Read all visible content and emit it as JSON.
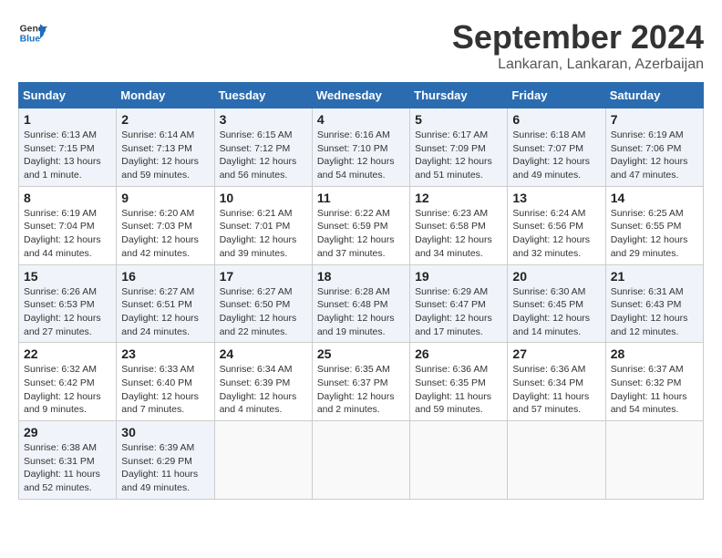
{
  "logo": {
    "line1": "General",
    "line2": "Blue"
  },
  "title": "September 2024",
  "location": "Lankaran, Lankaran, Azerbaijan",
  "weekdays": [
    "Sunday",
    "Monday",
    "Tuesday",
    "Wednesday",
    "Thursday",
    "Friday",
    "Saturday"
  ],
  "weeks": [
    [
      {
        "day": "1",
        "info": "Sunrise: 6:13 AM\nSunset: 7:15 PM\nDaylight: 13 hours\nand 1 minute."
      },
      {
        "day": "2",
        "info": "Sunrise: 6:14 AM\nSunset: 7:13 PM\nDaylight: 12 hours\nand 59 minutes."
      },
      {
        "day": "3",
        "info": "Sunrise: 6:15 AM\nSunset: 7:12 PM\nDaylight: 12 hours\nand 56 minutes."
      },
      {
        "day": "4",
        "info": "Sunrise: 6:16 AM\nSunset: 7:10 PM\nDaylight: 12 hours\nand 54 minutes."
      },
      {
        "day": "5",
        "info": "Sunrise: 6:17 AM\nSunset: 7:09 PM\nDaylight: 12 hours\nand 51 minutes."
      },
      {
        "day": "6",
        "info": "Sunrise: 6:18 AM\nSunset: 7:07 PM\nDaylight: 12 hours\nand 49 minutes."
      },
      {
        "day": "7",
        "info": "Sunrise: 6:19 AM\nSunset: 7:06 PM\nDaylight: 12 hours\nand 47 minutes."
      }
    ],
    [
      {
        "day": "8",
        "info": "Sunrise: 6:19 AM\nSunset: 7:04 PM\nDaylight: 12 hours\nand 44 minutes."
      },
      {
        "day": "9",
        "info": "Sunrise: 6:20 AM\nSunset: 7:03 PM\nDaylight: 12 hours\nand 42 minutes."
      },
      {
        "day": "10",
        "info": "Sunrise: 6:21 AM\nSunset: 7:01 PM\nDaylight: 12 hours\nand 39 minutes."
      },
      {
        "day": "11",
        "info": "Sunrise: 6:22 AM\nSunset: 6:59 PM\nDaylight: 12 hours\nand 37 minutes."
      },
      {
        "day": "12",
        "info": "Sunrise: 6:23 AM\nSunset: 6:58 PM\nDaylight: 12 hours\nand 34 minutes."
      },
      {
        "day": "13",
        "info": "Sunrise: 6:24 AM\nSunset: 6:56 PM\nDaylight: 12 hours\nand 32 minutes."
      },
      {
        "day": "14",
        "info": "Sunrise: 6:25 AM\nSunset: 6:55 PM\nDaylight: 12 hours\nand 29 minutes."
      }
    ],
    [
      {
        "day": "15",
        "info": "Sunrise: 6:26 AM\nSunset: 6:53 PM\nDaylight: 12 hours\nand 27 minutes."
      },
      {
        "day": "16",
        "info": "Sunrise: 6:27 AM\nSunset: 6:51 PM\nDaylight: 12 hours\nand 24 minutes."
      },
      {
        "day": "17",
        "info": "Sunrise: 6:27 AM\nSunset: 6:50 PM\nDaylight: 12 hours\nand 22 minutes."
      },
      {
        "day": "18",
        "info": "Sunrise: 6:28 AM\nSunset: 6:48 PM\nDaylight: 12 hours\nand 19 minutes."
      },
      {
        "day": "19",
        "info": "Sunrise: 6:29 AM\nSunset: 6:47 PM\nDaylight: 12 hours\nand 17 minutes."
      },
      {
        "day": "20",
        "info": "Sunrise: 6:30 AM\nSunset: 6:45 PM\nDaylight: 12 hours\nand 14 minutes."
      },
      {
        "day": "21",
        "info": "Sunrise: 6:31 AM\nSunset: 6:43 PM\nDaylight: 12 hours\nand 12 minutes."
      }
    ],
    [
      {
        "day": "22",
        "info": "Sunrise: 6:32 AM\nSunset: 6:42 PM\nDaylight: 12 hours\nand 9 minutes."
      },
      {
        "day": "23",
        "info": "Sunrise: 6:33 AM\nSunset: 6:40 PM\nDaylight: 12 hours\nand 7 minutes."
      },
      {
        "day": "24",
        "info": "Sunrise: 6:34 AM\nSunset: 6:39 PM\nDaylight: 12 hours\nand 4 minutes."
      },
      {
        "day": "25",
        "info": "Sunrise: 6:35 AM\nSunset: 6:37 PM\nDaylight: 12 hours\nand 2 minutes."
      },
      {
        "day": "26",
        "info": "Sunrise: 6:36 AM\nSunset: 6:35 PM\nDaylight: 11 hours\nand 59 minutes."
      },
      {
        "day": "27",
        "info": "Sunrise: 6:36 AM\nSunset: 6:34 PM\nDaylight: 11 hours\nand 57 minutes."
      },
      {
        "day": "28",
        "info": "Sunrise: 6:37 AM\nSunset: 6:32 PM\nDaylight: 11 hours\nand 54 minutes."
      }
    ],
    [
      {
        "day": "29",
        "info": "Sunrise: 6:38 AM\nSunset: 6:31 PM\nDaylight: 11 hours\nand 52 minutes."
      },
      {
        "day": "30",
        "info": "Sunrise: 6:39 AM\nSunset: 6:29 PM\nDaylight: 11 hours\nand 49 minutes."
      },
      {
        "day": "",
        "info": ""
      },
      {
        "day": "",
        "info": ""
      },
      {
        "day": "",
        "info": ""
      },
      {
        "day": "",
        "info": ""
      },
      {
        "day": "",
        "info": ""
      }
    ]
  ]
}
